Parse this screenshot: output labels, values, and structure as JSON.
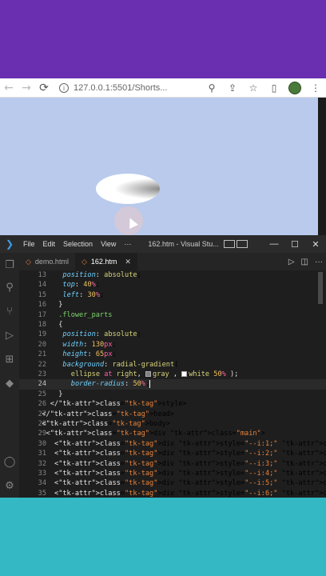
{
  "browser": {
    "url": "127.0.0.1:5501/Shorts..."
  },
  "vscode": {
    "menu": [
      "File",
      "Edit",
      "Selection",
      "View"
    ],
    "title": "162.htm - Visual Stu...",
    "tabs": [
      {
        "label": "demo.html",
        "active": false
      },
      {
        "label": "162.htm",
        "active": true
      }
    ]
  },
  "code_lines": [
    {
      "n": "13",
      "code": "position: absolute;"
    },
    {
      "n": "14",
      "code": "top: 40%;"
    },
    {
      "n": "15",
      "code": "left: 30%;"
    },
    {
      "n": "16",
      "code": "}"
    },
    {
      "n": "17",
      "code": ".flower_parts"
    },
    {
      "n": "18",
      "code": "{"
    },
    {
      "n": "19",
      "code": "position: absolute;"
    },
    {
      "n": "20",
      "code": "width: 130px;"
    },
    {
      "n": "21",
      "code": "height: 65px;"
    },
    {
      "n": "22",
      "code": "background: radial-gradient("
    },
    {
      "n": "23",
      "code": "ellipse at right, gray , white 50% );"
    },
    {
      "n": "24",
      "code": "border-radius: 50%;"
    },
    {
      "n": "25",
      "code": "}"
    },
    {
      "n": "26",
      "code": "</style>"
    },
    {
      "n": "27",
      "code": "</head>"
    },
    {
      "n": "28",
      "code": "<body>"
    },
    {
      "n": "29",
      "code": "<div class=\"main\">"
    },
    {
      "n": "30",
      "code": "<div style=\"--i:1;\" class=\"flower_parts\"></div>"
    },
    {
      "n": "31",
      "code": "<div style=\"--i:2;\" class=\"flower_parts \"></div>"
    },
    {
      "n": "32",
      "code": "<div style=\"--i:3;\" class=\"flower_parts \"></div>"
    },
    {
      "n": "33",
      "code": "<div style=\"--i:4;\" class=\"flower_parts \"></div>"
    },
    {
      "n": "34",
      "code": "<div style=\"--i:5;\" class=\"flower_parts \"></div>"
    },
    {
      "n": "35",
      "code": "<div style=\"--i:6;\" class=\"flower_parts \"></div>"
    }
  ],
  "colors": {
    "top_bg": "#6a2fb0",
    "bottom_bg": "#33b8c4",
    "viewport_bg": "#b9caec",
    "editor_bg": "#1e1e1e"
  }
}
